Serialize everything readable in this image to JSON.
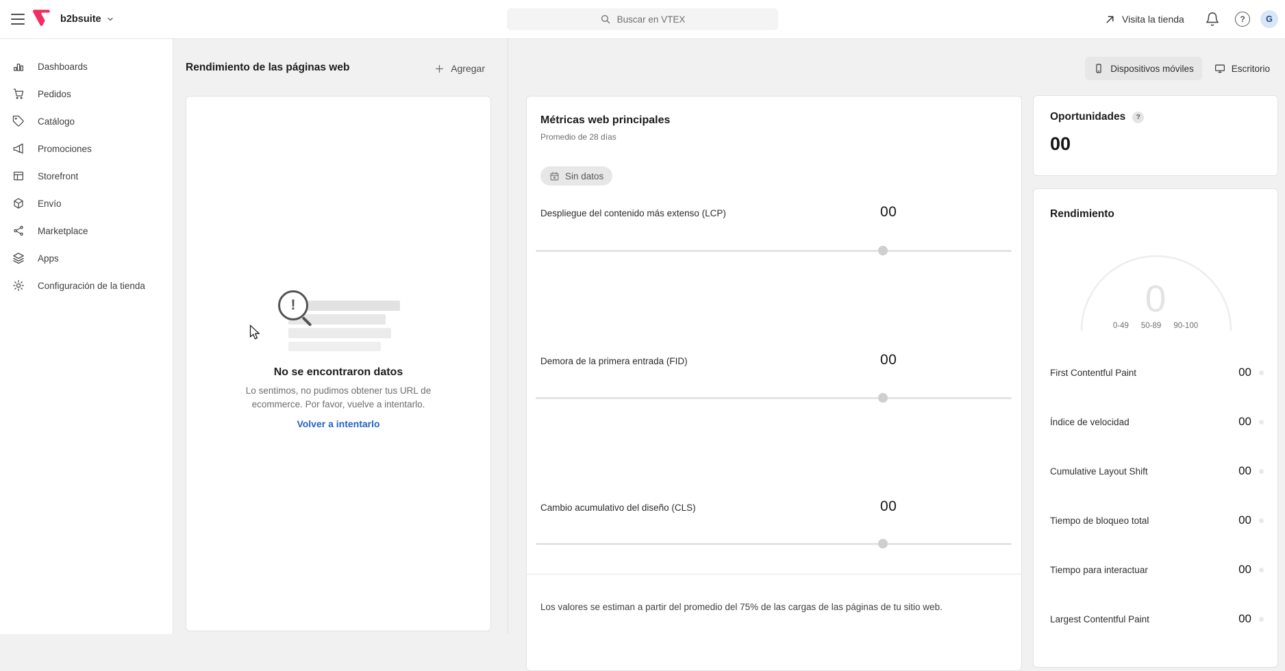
{
  "colors": {
    "brand_pink": "#F02E5F",
    "link_blue": "#2262C6",
    "toggle_selected_bg": "#E7E7E7"
  },
  "topbar": {
    "account_name": "b2bsuite",
    "search_placeholder": "Buscar en VTEX",
    "visit_store_label": "Visita la tienda",
    "help_glyph": "?",
    "avatar_initial": "G"
  },
  "sidebar": {
    "items": [
      {
        "label": "Dashboards",
        "icon": "bar-chart-icon"
      },
      {
        "label": "Pedidos",
        "icon": "cart-icon"
      },
      {
        "label": "Catálogo",
        "icon": "tag-icon"
      },
      {
        "label": "Promociones",
        "icon": "megaphone-icon"
      },
      {
        "label": "Storefront",
        "icon": "storefront-icon"
      },
      {
        "label": "Envío",
        "icon": "package-icon"
      },
      {
        "label": "Marketplace",
        "icon": "marketplace-icon"
      },
      {
        "label": "Apps",
        "icon": "layers-icon"
      },
      {
        "label": "Configuración de la tienda",
        "icon": "gear-icon"
      }
    ]
  },
  "pages_panel": {
    "title": "Rendimiento de las páginas web",
    "add_label": "Agregar",
    "empty_state": {
      "alert_glyph": "!",
      "title": "No se encontraron datos",
      "message": "Lo sentimos, no pudimos obtener tus URL de ecommerce. Por favor, vuelve a intentarlo.",
      "retry_label": "Volver a intentarlo"
    }
  },
  "device_toggle": {
    "mobile_label": "Dispositivos móviles",
    "desktop_label": "Escritorio"
  },
  "metrics_card": {
    "title": "Métricas web principales",
    "subtitle": "Promedio de 28 días",
    "no_data_badge": "Sin datos",
    "metrics": [
      {
        "label": "Despliegue del contenido más extenso (LCP)",
        "value": "00",
        "slider_percent": 73
      },
      {
        "label": "Demora de la primera entrada (FID)",
        "value": "00",
        "slider_percent": 73
      },
      {
        "label": "Cambio acumulativo del diseño (CLS)",
        "value": "00",
        "slider_percent": 73
      }
    ],
    "footnote": "Los valores se estiman a partir del promedio del 75% de las cargas de las páginas de tu sitio web."
  },
  "opportunities_card": {
    "title": "Oportunidades",
    "help_badge": "?",
    "value": "00"
  },
  "performance_card": {
    "title": "Rendimiento",
    "gauge": {
      "value": "0",
      "ranges": [
        "0-49",
        "50-89",
        "90-100"
      ]
    },
    "metrics": [
      {
        "label": "First Contentful Paint",
        "value": "00"
      },
      {
        "label": "Índice de velocidad",
        "value": "00"
      },
      {
        "label": "Cumulative Layout Shift",
        "value": "00"
      },
      {
        "label": "Tiempo de bloqueo total",
        "value": "00"
      },
      {
        "label": "Tiempo para interactuar",
        "value": "00"
      },
      {
        "label": "Largest Contentful Paint",
        "value": "00"
      }
    ]
  }
}
